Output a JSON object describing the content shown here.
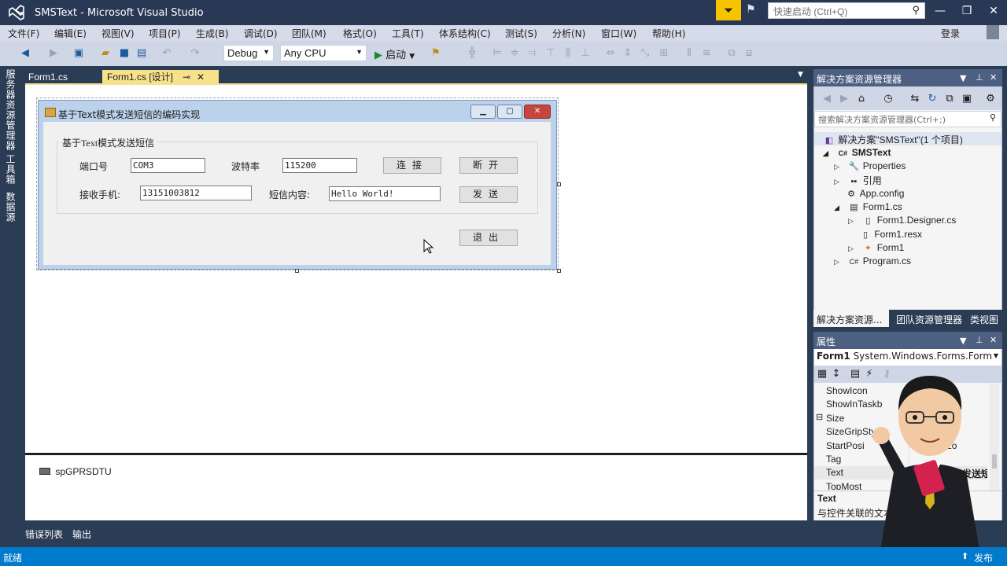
{
  "window": {
    "title": "SMSText - Microsoft Visual Studio",
    "quick_launch_placeholder": "快速启动 (Ctrl+Q)",
    "minimize": "—",
    "restore": "❐",
    "close": "✕"
  },
  "menu": {
    "items": [
      "文件(F)",
      "编辑(E)",
      "视图(V)",
      "项目(P)",
      "生成(B)",
      "调试(D)",
      "团队(M)",
      "格式(O)",
      "工具(T)",
      "体系结构(C)",
      "测试(S)",
      "分析(N)",
      "窗口(W)",
      "帮助(H)"
    ],
    "sign_in": "登录"
  },
  "toolbar": {
    "config": "Debug",
    "platform": "Any CPU",
    "start": "启动"
  },
  "left_strip": {
    "tabs": [
      "服务器资源管理器",
      "工具箱",
      "数据源"
    ]
  },
  "doc_tabs": [
    {
      "label": "Form1.cs"
    },
    {
      "label": "Form1.cs [设计]",
      "pin": "⊸",
      "close": "✕"
    }
  ],
  "form": {
    "title": "基于Text模式发送短信的编码实现",
    "group_title": "基于Text模式发送短信",
    "port_label": "端口号",
    "port_value": "COM3",
    "baud_label": "波特率",
    "baud_value": "115200",
    "connect_button": "连接",
    "disconnect_button": "断开",
    "phone_label": "接收手机:",
    "phone_value": "13151003812",
    "content_label": "短信内容:",
    "content_value": "Hello World!",
    "send_button": "发送",
    "exit_button": "退出"
  },
  "tray": {
    "component": "spGPRSDTU"
  },
  "bottom_tabs": [
    "错误列表",
    "输出"
  ],
  "status": {
    "ready": "就绪",
    "publish": "发布"
  },
  "solution_explorer": {
    "title": "解决方案资源管理器",
    "search_placeholder": "搜索解决方案资源管理器(Ctrl+;)",
    "tree": [
      {
        "label": "解决方案\"SMSText\"(1 个项目)"
      },
      {
        "label": "SMSText"
      },
      {
        "label": "Properties"
      },
      {
        "label": "引用"
      },
      {
        "label": "App.config"
      },
      {
        "label": "Form1.cs"
      },
      {
        "label": "Form1.Designer.cs"
      },
      {
        "label": "Form1.resx"
      },
      {
        "label": "Form1"
      },
      {
        "label": "Program.cs"
      }
    ],
    "bottom_tabs": [
      "解决方案资源...",
      "团队资源管理器",
      "类视图"
    ]
  },
  "properties": {
    "title": "属性",
    "object_name": "Form1",
    "object_type": "System.Windows.Forms.Form",
    "rows": [
      {
        "name": "ShowIcon",
        "value": ""
      },
      {
        "name": "ShowInTaskb",
        "value": ""
      },
      {
        "name": "Size",
        "value": ""
      },
      {
        "name": "SizeGripStyle",
        "value": ""
      },
      {
        "name": "StartPosi",
        "value": "sDefaultLo"
      },
      {
        "name": "Tag",
        "value": ""
      },
      {
        "name": "Text",
        "value": "模式发送短"
      },
      {
        "name": "TopMost",
        "value": ""
      }
    ],
    "desc_title": "Text",
    "desc_text": "与控件关联的文本"
  },
  "colors": {
    "vs_dark": "#293955",
    "active_tab": "#f7e28b",
    "status_bar": "#007acc",
    "filter_badge": "#f7c200"
  }
}
